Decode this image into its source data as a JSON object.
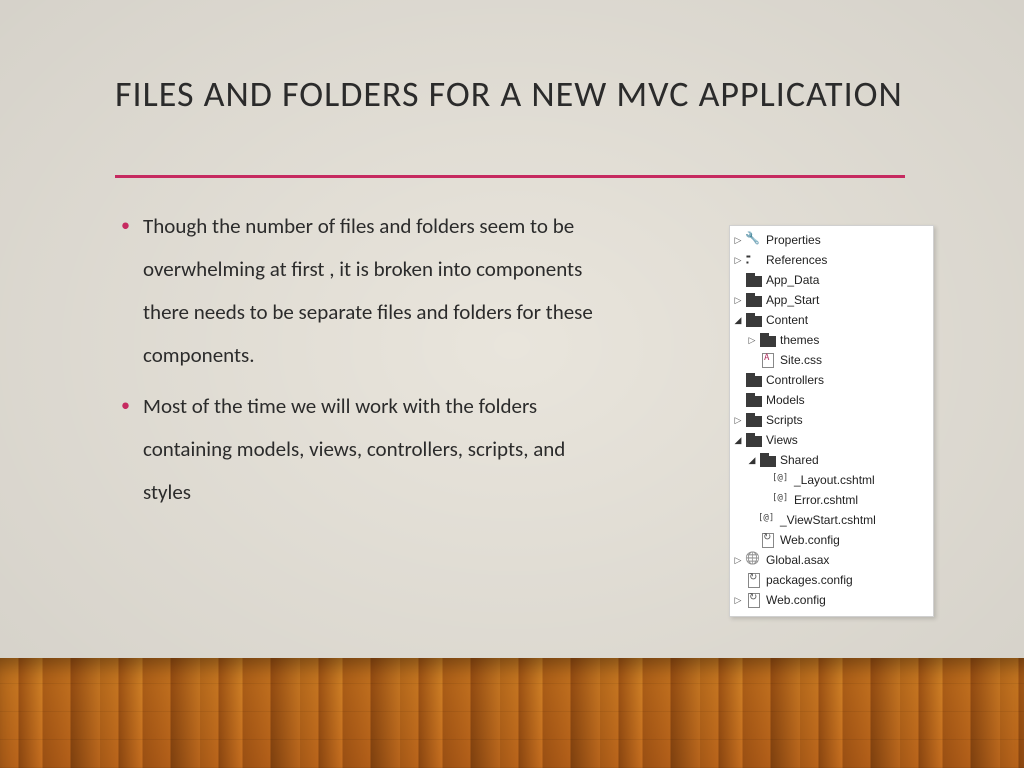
{
  "title": "FILES AND FOLDERS FOR A NEW MVC APPLICATION",
  "bullets": [
    "Though the number of files and folders seem to be overwhelming at first , it is broken into components there needs to be separate files and folders for these components.",
    "Most of the time we will work with the folders containing models, views, controllers, scripts, and styles"
  ],
  "tree": [
    {
      "depth": 0,
      "twisty": "closed",
      "icon": "wrench",
      "label": "Properties"
    },
    {
      "depth": 0,
      "twisty": "closed",
      "icon": "refs",
      "label": "References"
    },
    {
      "depth": 0,
      "twisty": "none",
      "icon": "folder-dark",
      "label": "App_Data"
    },
    {
      "depth": 0,
      "twisty": "closed",
      "icon": "folder-dark",
      "label": "App_Start"
    },
    {
      "depth": 0,
      "twisty": "open",
      "icon": "folder-dark",
      "label": "Content"
    },
    {
      "depth": 1,
      "twisty": "closed",
      "icon": "folder-dark",
      "label": "themes"
    },
    {
      "depth": 1,
      "twisty": "none",
      "icon": "css",
      "label": "Site.css"
    },
    {
      "depth": 0,
      "twisty": "none",
      "icon": "folder-dark",
      "label": "Controllers"
    },
    {
      "depth": 0,
      "twisty": "none",
      "icon": "folder-dark",
      "label": "Models"
    },
    {
      "depth": 0,
      "twisty": "closed",
      "icon": "folder-dark",
      "label": "Scripts"
    },
    {
      "depth": 0,
      "twisty": "open",
      "icon": "folder-dark",
      "label": "Views"
    },
    {
      "depth": 1,
      "twisty": "open",
      "icon": "folder-dark",
      "label": "Shared"
    },
    {
      "depth": 2,
      "twisty": "none",
      "icon": "cshtml",
      "label": "_Layout.cshtml"
    },
    {
      "depth": 2,
      "twisty": "none",
      "icon": "cshtml",
      "label": "Error.cshtml"
    },
    {
      "depth": 1,
      "twisty": "none",
      "icon": "cshtml",
      "label": "_ViewStart.cshtml"
    },
    {
      "depth": 1,
      "twisty": "none",
      "icon": "cfg",
      "label": "Web.config"
    },
    {
      "depth": 0,
      "twisty": "closed",
      "icon": "globe",
      "label": "Global.asax"
    },
    {
      "depth": 0,
      "twisty": "none",
      "icon": "cfg",
      "label": "packages.config"
    },
    {
      "depth": 0,
      "twisty": "closed",
      "icon": "cfg",
      "label": "Web.config"
    }
  ]
}
